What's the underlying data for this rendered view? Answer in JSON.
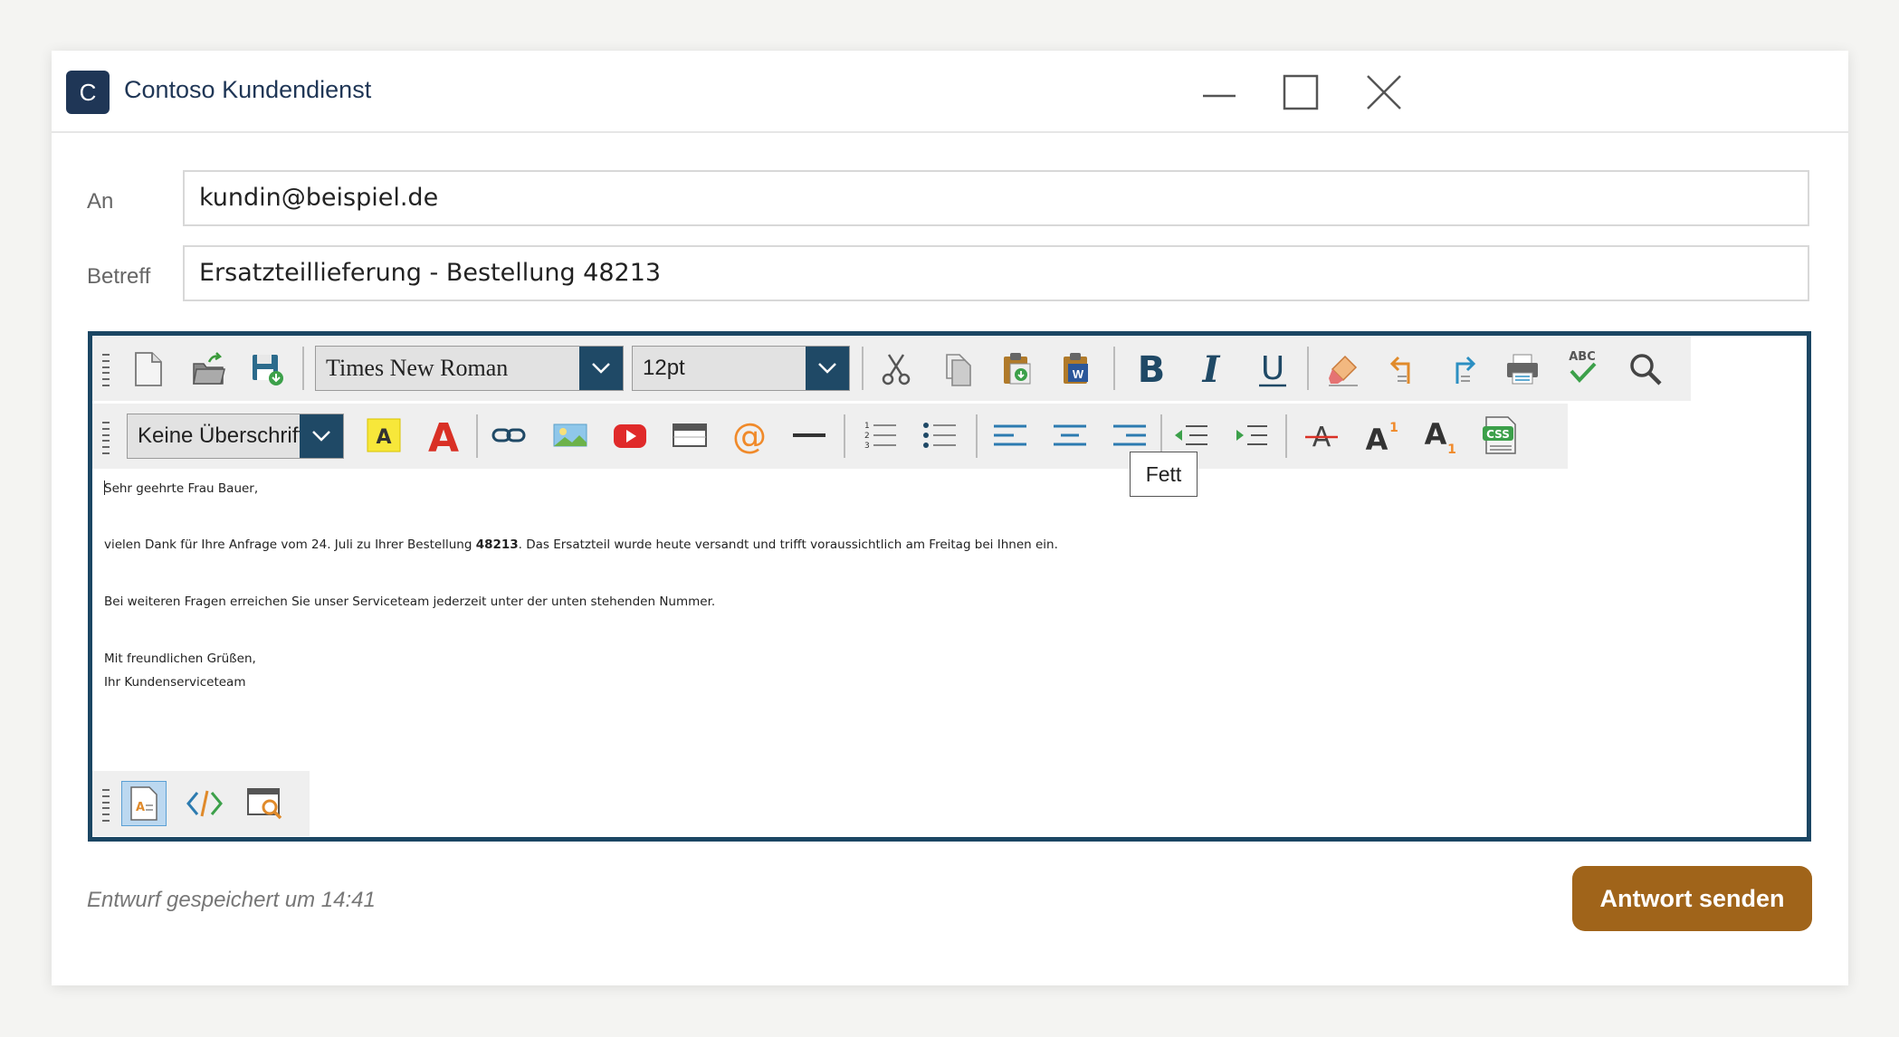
{
  "window": {
    "app_icon_letter": "C",
    "title": "Contoso Kundendienst"
  },
  "fields": {
    "to_label": "An",
    "to_value": "kundin@beispiel.de",
    "subject_label": "Betreff",
    "subject_value": "Ersatzteillieferung - Bestellung 48213"
  },
  "toolbar": {
    "font_family": "Times New Roman",
    "font_size": "12pt",
    "heading": "Keine Überschrift",
    "tooltip": "Fett",
    "spell_label": "ABC",
    "css_label": "CSS",
    "superscript_mark": "1",
    "subscript_mark": "1"
  },
  "body": {
    "greeting": "Sehr geehrte Frau Bauer,",
    "line1_pre": "vielen Dank für Ihre Anfrage vom 24. Juli zu Ihrer Bestellung ",
    "line1_bold": "48213",
    "line1_post": ". Das Ersatzteil wurde heute versandt und trifft voraussichtlich am Freitag bei Ihnen ein.",
    "line2": "Bei weiteren Fragen erreichen Sie unser Serviceteam jederzeit unter der unten stehenden Nummer.",
    "closing": "Mit freundlichen Grüßen,",
    "signature": "Ihr Kundenserviceteam"
  },
  "footer": {
    "status": "Entwurf gespeichert um 14:41",
    "send_label": "Antwort senden"
  },
  "colors": {
    "brand": "#1f3656",
    "editor_border": "#1b4663",
    "send_button": "#a0641a"
  }
}
